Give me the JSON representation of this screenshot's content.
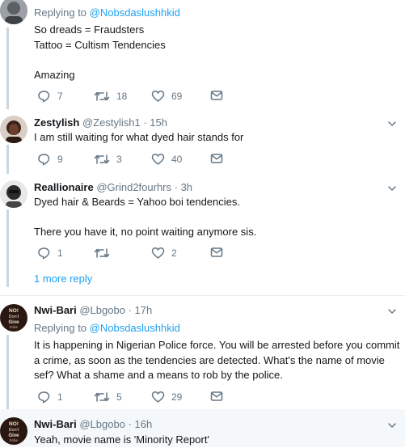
{
  "tweets": [
    {
      "reply_prefix": "Replying to ",
      "reply_handle": "@Nobsdaslushhkid",
      "text": "So dreads = Fraudsters\nTattoo = Cultism Tendencies\n\nAmazing",
      "replies": "7",
      "retweets": "18",
      "likes": "69"
    },
    {
      "name": "Zestylish",
      "handle": "@Zestylish1",
      "time": "· 15h",
      "text": "I am still waiting for what dyed hair stands for",
      "replies": "9",
      "retweets": "3",
      "likes": "40"
    },
    {
      "name": "Reallionaire",
      "handle": "@Grind2fourhrs",
      "time": "· 3h",
      "text": "Dyed hair & Beards = Yahoo boi tendencies.\n\nThere you have it, no point waiting anymore sis.",
      "replies": "1",
      "retweets": "",
      "likes": "2"
    },
    {
      "name": "Nwi-Bari",
      "handle": "@Lbgobo",
      "time": "· 17h",
      "reply_prefix": "Replying to ",
      "reply_handle": "@Nobsdaslushhkid",
      "text": "It is happening in Nigerian Police force. You will be arrested before you commit a crime, as soon as the tendencies are detected. What's the name of movie sef? What a shame and a means to rob by the police.",
      "replies": "1",
      "retweets": "5",
      "likes": "29"
    },
    {
      "name": "Nwi-Bari",
      "handle": "@Lbgobo",
      "time": "· 16h",
      "text": "Yeah, movie name is 'Minority Report'"
    }
  ],
  "more_replies": "1 more reply",
  "avatar_badge_text": "NO!\nDon't\nGive\nbribe",
  "colors": {
    "link": "#1da1f2",
    "muted": "#657786",
    "thread": "#ccd6dd",
    "separator": "#e6ecf0"
  },
  "icons": [
    "reply-icon",
    "retweet-icon",
    "like-icon",
    "dm-icon",
    "chevron-down-icon"
  ]
}
